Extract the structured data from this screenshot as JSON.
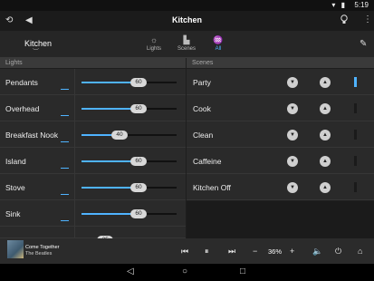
{
  "status": {
    "time": "5:19",
    "icons": "▾ ▮"
  },
  "topbar": {
    "title": "Kitchen",
    "logo_icon": "app-logo-icon",
    "back_icon": "back-arrow-icon",
    "bulb_icon": "bulb-icon",
    "menu_icon": "overflow-menu-icon"
  },
  "room": {
    "name": "Kitchen"
  },
  "tabs": [
    {
      "label": "Lights",
      "icon": "bulb-icon"
    },
    {
      "label": "Scenes",
      "icon": "scenes-icon"
    },
    {
      "label": "All",
      "icon": "all-icon"
    }
  ],
  "sections": {
    "lights": "Lights",
    "scenes": "Scenes"
  },
  "lights": [
    {
      "name": "Pendants",
      "level": 60
    },
    {
      "name": "Overhead",
      "level": 60
    },
    {
      "name": "Breakfast Nook",
      "level": 40
    },
    {
      "name": "Island",
      "level": 60
    },
    {
      "name": "Stove",
      "level": 60
    },
    {
      "name": "Sink",
      "level": 60
    },
    {
      "name": "",
      "level": 25
    }
  ],
  "scenes": [
    {
      "name": "Party",
      "active": true
    },
    {
      "name": "Cook",
      "active": false
    },
    {
      "name": "Clean",
      "active": false
    },
    {
      "name": "Caffeine",
      "active": false
    },
    {
      "name": "Kitchen Off",
      "active": false
    }
  ],
  "player": {
    "song": "Come Together",
    "artist": "The Beatles",
    "volume": "36%"
  },
  "colors": {
    "accent": "#4fb3ff",
    "background": "#1e1e1e",
    "row": "#2a2a2a"
  }
}
